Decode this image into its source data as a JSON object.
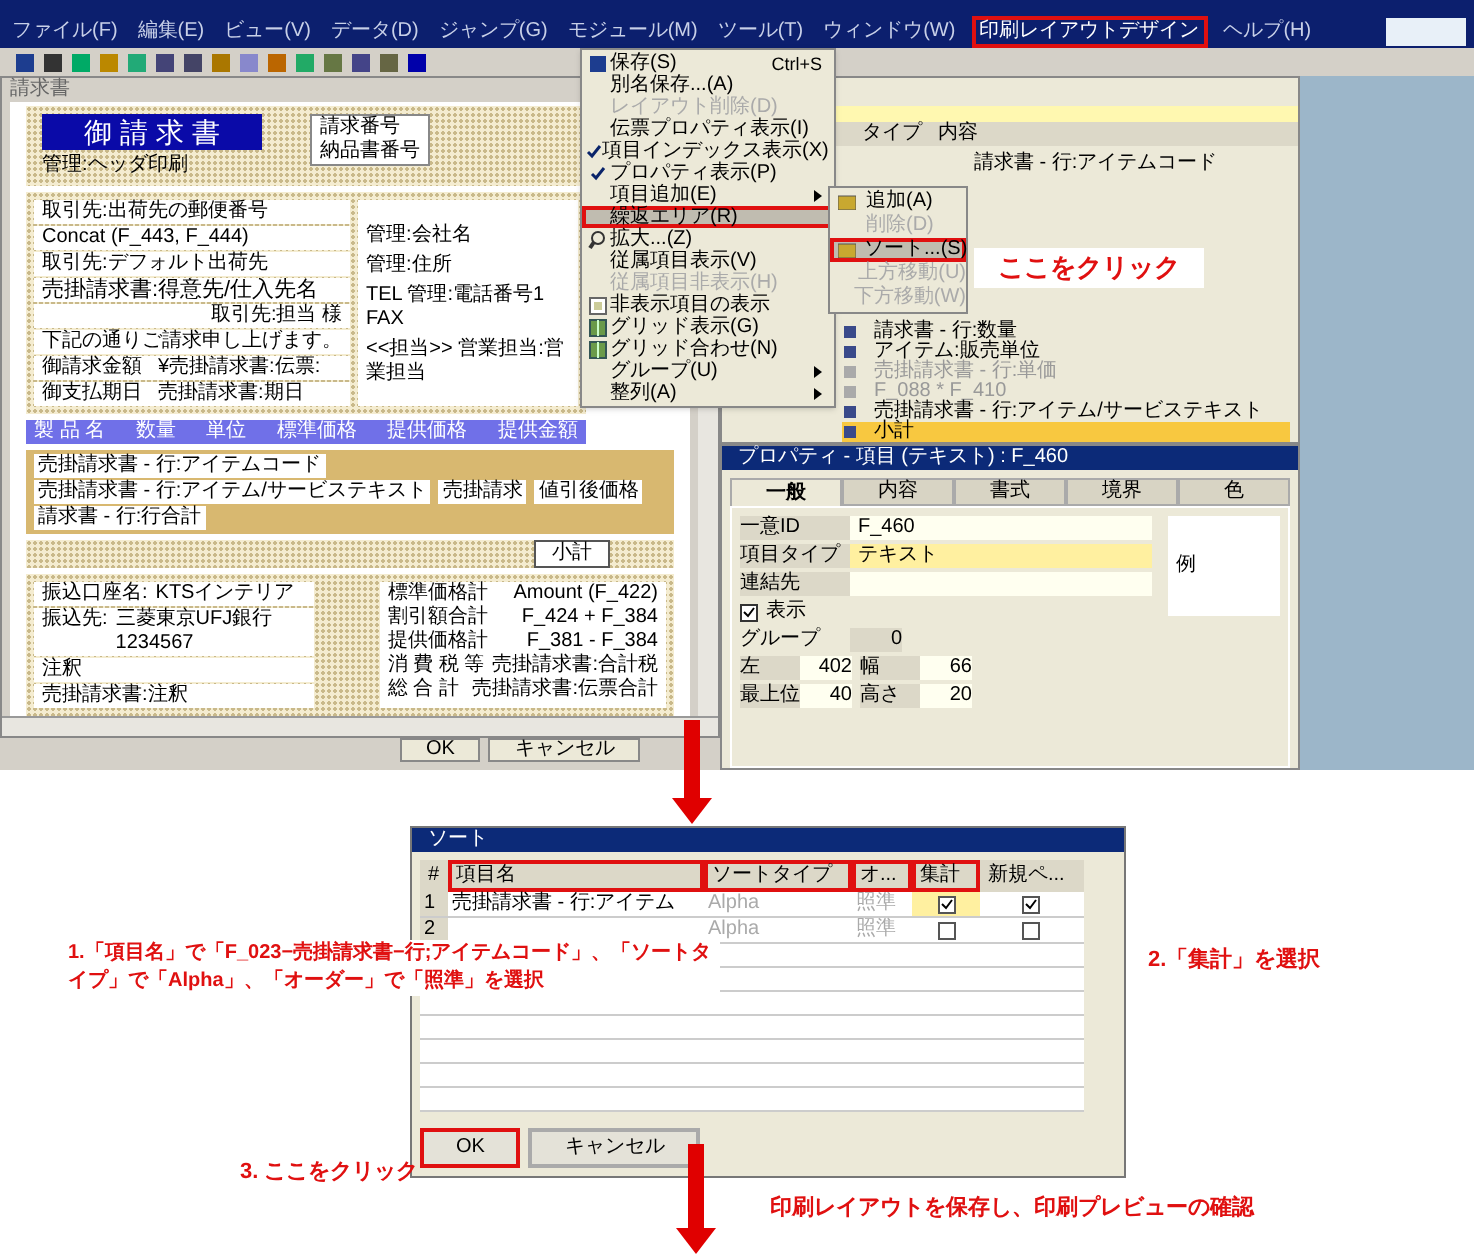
{
  "menu_bar": [
    {
      "label": "ファイル(F)",
      "selected": false
    },
    {
      "label": "編集(E)",
      "selected": false
    },
    {
      "label": "ビュー(V)",
      "selected": false
    },
    {
      "label": "データ(D)",
      "selected": false
    },
    {
      "label": "ジャンプ(G)",
      "selected": false
    },
    {
      "label": "モジュール(M)",
      "selected": false
    },
    {
      "label": "ツール(T)",
      "selected": false
    },
    {
      "label": "ウィンドウ(W)",
      "selected": false
    },
    {
      "label": "印刷レイアウトデザイン",
      "selected": true
    },
    {
      "label": "ヘルプ(H)",
      "selected": false
    }
  ],
  "document": {
    "title": "請求書",
    "heading": "御 請 求 書",
    "header_note": "管理:ヘッダ印刷",
    "number_box": [
      "請求番号",
      "納品書番号"
    ],
    "left_fields": [
      "取引先:出荷先の郵便番号",
      "Concat (F_443, F_444)",
      "取引先:デフォルト出荷先",
      "売掛請求書:得意先/仕入先名",
      "取引先:担当 様",
      "下記の通りご請求申し上げます。"
    ],
    "amount_rows": [
      [
        "御請求金額",
        "¥売掛請求書:伝票:"
      ],
      [
        "御支払期日",
        "売掛請求書:期日"
      ]
    ],
    "right_fields": [
      "管理:会社名",
      "管理:住所",
      "TEL 管理:電話番号1 FAX",
      "<<担当>> 営業担当:営業担当"
    ],
    "table_header": [
      "製 品 名",
      "数量",
      "単位",
      "標準価格",
      "提供価格",
      "提供金額"
    ],
    "table_rows": [
      "売掛請求書 - 行:アイテムコード",
      "売掛請求書 - 行:アイテム/サービステキスト",
      "売掛請求",
      "値引後価格",
      "請求書 - 行:行合計"
    ],
    "subtotal": "小計",
    "bank": [
      [
        "振込口座名:",
        "KTSインテリア"
      ],
      [
        "振込先:",
        "三菱東京UFJ銀行 1234567"
      ]
    ],
    "notes": [
      "注釈",
      "売掛請求書:注釈"
    ],
    "totals": [
      [
        "標準価格計",
        "Amount (F_422)"
      ],
      [
        "割引額合計",
        "F_424 + F_384"
      ],
      [
        "提供価格計",
        "F_381 - F_384"
      ],
      [
        "消 費 税 等",
        "売掛請求書:合計税"
      ],
      [
        "総 合 計",
        "売掛請求書:伝票合計"
      ]
    ]
  },
  "hidden_buttons": [
    "OK",
    "キャンセル"
  ],
  "dropdown": [
    {
      "label": "保存(S)",
      "shortcut": "Ctrl+S",
      "checked": false,
      "disabled": false,
      "highlighted": false,
      "submenu": false
    },
    {
      "label": "別名保存...(A)",
      "checked": false,
      "disabled": false,
      "highlighted": false,
      "submenu": false
    },
    {
      "label": "レイアウト削除(D)",
      "checked": false,
      "disabled": true,
      "highlighted": false,
      "submenu": false
    },
    {
      "label": "伝票プロパティ表示(I)",
      "checked": false,
      "disabled": false,
      "highlighted": false,
      "submenu": false
    },
    {
      "label": "項目インデックス表示(X)",
      "checked": true,
      "disabled": false,
      "highlighted": false,
      "submenu": false
    },
    {
      "label": "プロパティ表示(P)",
      "checked": true,
      "disabled": false,
      "highlighted": false,
      "submenu": false
    },
    {
      "label": "項目追加(E)",
      "checked": false,
      "disabled": false,
      "highlighted": false,
      "submenu": true
    },
    {
      "label": "繰返エリア(R)",
      "checked": false,
      "disabled": false,
      "highlighted": true,
      "submenu": false
    },
    {
      "label": "拡大...(Z)",
      "checked": false,
      "disabled": false,
      "highlighted": false,
      "submenu": false
    },
    {
      "label": "従属項目表示(V)",
      "checked": false,
      "disabled": false,
      "highlighted": false,
      "submenu": false
    },
    {
      "label": "従属項目非表示(H)",
      "checked": false,
      "disabled": true,
      "highlighted": false,
      "submenu": false
    },
    {
      "label": "非表示項目の表示",
      "checked": false,
      "disabled": false,
      "highlighted": false,
      "submenu": false
    },
    {
      "label": "グリッド表示(G)",
      "checked": false,
      "disabled": false,
      "highlighted": false,
      "submenu": false
    },
    {
      "label": "グリッド合わせ(N)",
      "checked": false,
      "disabled": false,
      "highlighted": false,
      "submenu": false
    },
    {
      "label": "グループ(U)",
      "checked": false,
      "disabled": false,
      "highlighted": false,
      "submenu": true
    },
    {
      "label": "整列(A)",
      "checked": false,
      "disabled": false,
      "highlighted": false,
      "submenu": true
    }
  ],
  "submenu": [
    {
      "label": "追加(A)",
      "disabled": false,
      "highlighted": false
    },
    {
      "label": "削除(D)",
      "disabled": true,
      "highlighted": false
    },
    {
      "label": "ソート...(S)",
      "disabled": false,
      "highlighted": true
    },
    {
      "label": "上方移動(U)",
      "disabled": true,
      "highlighted": false
    },
    {
      "label": "下方移動(W)",
      "disabled": true,
      "highlighted": false
    }
  ],
  "callout_menu": "ここをクリック",
  "item_list": {
    "columns": [
      "タイプ",
      "内容"
    ],
    "rows": [
      {
        "content": "請求書 - 行:アイテムコード",
        "disabled": false,
        "selected": false
      },
      {
        "content": "請求書 - 行:数量",
        "disabled": false,
        "selected": false
      },
      {
        "content": "アイテム:販売単位",
        "disabled": false,
        "selected": false
      },
      {
        "content": "売掛請求書 - 行:単価",
        "disabled": true,
        "selected": false
      },
      {
        "content": "F_088 * F_410",
        "disabled": true,
        "selected": false
      },
      {
        "content": "売掛請求書 - 行:アイテム/サービステキスト",
        "disabled": false,
        "selected": false
      },
      {
        "content": "小計",
        "disabled": false,
        "selected": true
      }
    ]
  },
  "properties": {
    "title": "プロパティ - 項目 (テキスト) : F_460",
    "tabs": [
      {
        "label": "一般",
        "selected": true
      },
      {
        "label": "内容",
        "selected": false
      },
      {
        "label": "書式",
        "selected": false
      },
      {
        "label": "境界",
        "selected": false
      },
      {
        "label": "色",
        "selected": false
      }
    ],
    "unique_id": {
      "label": "一意ID",
      "value": "F_460"
    },
    "item_type": {
      "label": "項目タイプ",
      "value": "テキスト"
    },
    "link": {
      "label": "連結先"
    },
    "visible": {
      "label": "表示",
      "checked": true
    },
    "group": {
      "label": "グループ",
      "value": "0"
    },
    "left": {
      "label": "左",
      "value": "402"
    },
    "width": {
      "label": "幅",
      "value": "66"
    },
    "top": {
      "label": "最上位",
      "value": "40"
    },
    "height": {
      "label": "高さ",
      "value": "20"
    },
    "preview": "例"
  },
  "sort_dialog": {
    "title": "ソート",
    "columns": [
      {
        "label": "#",
        "highlighted": false
      },
      {
        "label": "項目名",
        "highlighted": true
      },
      {
        "label": "ソートタイプ",
        "highlighted": true
      },
      {
        "label": "オ...",
        "highlighted": true
      },
      {
        "label": "集計",
        "highlighted": true
      },
      {
        "label": "新規ペ...",
        "highlighted": false
      }
    ],
    "rows": [
      {
        "number": "1",
        "item": "売掛請求書 - 行:アイテム",
        "sort_type": "Alpha",
        "order": "照準",
        "total": true,
        "new_page": true
      },
      {
        "number": "2",
        "sort_type": "Alpha",
        "order": "照準",
        "total": false,
        "new_page": false
      }
    ],
    "buttons": [
      {
        "label": "OK",
        "highlighted": true
      },
      {
        "label": "キャンセル",
        "highlighted": false
      }
    ]
  },
  "annotations": [
    "1.「項目名」で「F_023−売掛請求書−行;アイテムコード」、「ソートタイプ」で「Alpha」、「オーダー」で「照準」を選択",
    "2.「集計」を選択",
    "3. ここをクリック",
    "印刷レイアウトを保存し、印刷プレビューの確認"
  ]
}
